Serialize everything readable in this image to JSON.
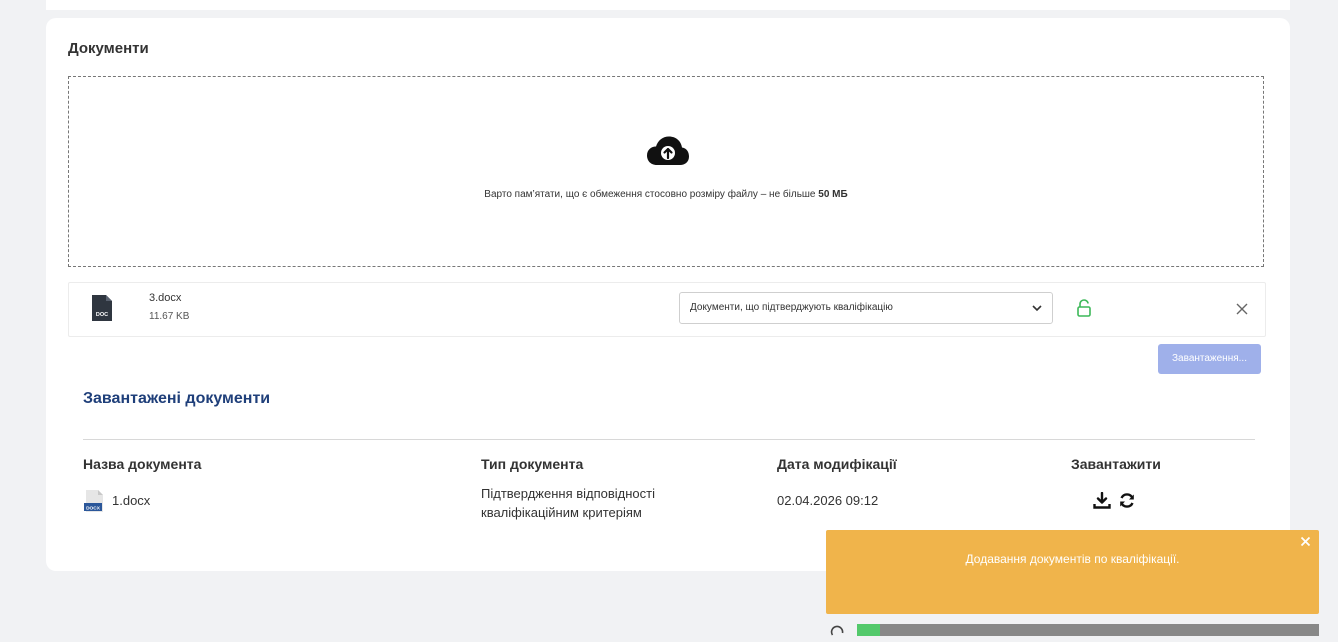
{
  "documents_section": {
    "title": "Документи",
    "dropzone": {
      "note_prefix": "Варто пам’ятати, що є обмеження стосовно розміру файлу – не більше ",
      "note_limit": "50 МБ",
      "icon": "cloud-upload-icon"
    },
    "pending_file": {
      "name": "3.docx",
      "size": "11.67 KB",
      "icon_label": "DOC",
      "selected_type": "Документи, що підтверджують кваліфікацію",
      "lock_color": "#3cb858"
    },
    "upload_button": "Завантаження..."
  },
  "uploaded_section": {
    "title": "Завантажені документи",
    "columns": [
      "Назва документа",
      "Тип документа",
      "Дата модифікації",
      "Завантажити"
    ],
    "rows": [
      {
        "name": "1.docx",
        "icon_label": "DOCX",
        "type_line1": "Підтвердження відповідності",
        "type_line2": "кваліфікаційним критеріям",
        "modified": "02.04.2026 09:12"
      }
    ]
  },
  "toast": {
    "message": "Додавання документів по кваліфікації.",
    "color": "#f0b44b"
  },
  "progress": {
    "fraction": 0.05,
    "fill_color": "#53c96b"
  }
}
